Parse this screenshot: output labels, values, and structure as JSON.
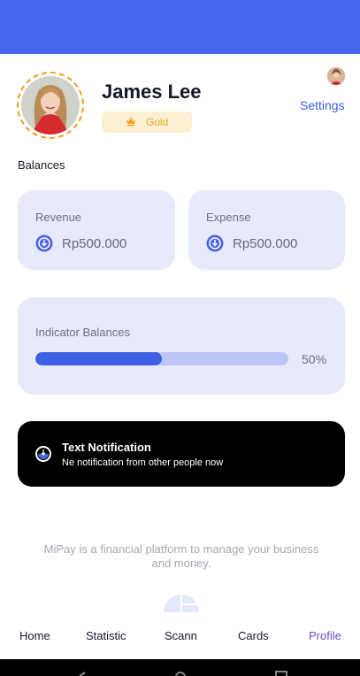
{
  "profile": {
    "name": "James Lee",
    "tier": "Gold",
    "settings_label": "Settings"
  },
  "balances": {
    "section_title": "Balances",
    "revenue": {
      "label": "Revenue",
      "value": "Rp500.000"
    },
    "expense": {
      "label": "Expense",
      "value": "Rp500.000"
    },
    "indicator": {
      "label": "Indicator Balances",
      "percent_text": "50%",
      "fraction": 0.5
    }
  },
  "notification": {
    "title": "Text Notification",
    "body": "Ne notification from other people now"
  },
  "footer": {
    "description": "MiPay is a financial platform to manage your business and money."
  },
  "nav": {
    "items": [
      {
        "label": "Home"
      },
      {
        "label": "Statistic"
      },
      {
        "label": "Scann"
      },
      {
        "label": "Cards"
      },
      {
        "label": "Profile",
        "active": true
      }
    ]
  },
  "colors": {
    "accent": "#4567ee",
    "gold": "#e8a621",
    "nav_active": "#6a4cc9"
  },
  "icons": {
    "coin": "coin-icon",
    "crown": "crown-icon",
    "notification": "notification-icon"
  }
}
